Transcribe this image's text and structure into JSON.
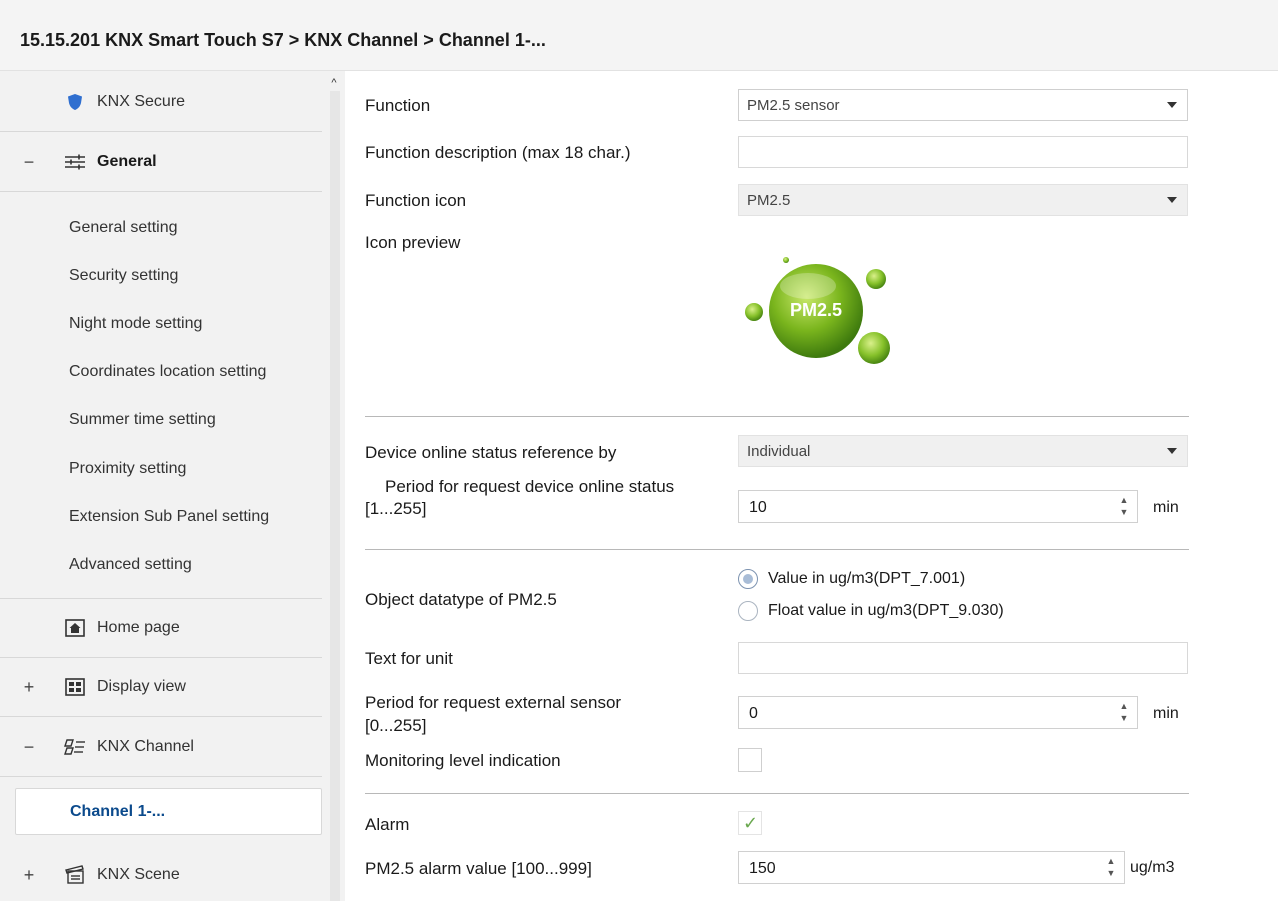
{
  "breadcrumb": "15.15.201 KNX Smart Touch S7 > KNX Channel  > Channel 1-...",
  "sidebar": {
    "knx_secure": "KNX Secure",
    "general": {
      "toggle": "−",
      "label": "General"
    },
    "general_items": [
      "General setting",
      "Security setting",
      "Night mode setting",
      "Coordinates location setting",
      "Summer time setting",
      "Proximity setting",
      "Extension Sub Panel setting",
      "Advanced setting"
    ],
    "home_page": "Home page",
    "display_view": {
      "toggle": "+",
      "label": "Display view"
    },
    "knx_channel": {
      "toggle": "−",
      "label": "KNX Channel"
    },
    "selected_channel": "Channel 1-...",
    "knx_scene": {
      "toggle": "+",
      "label": "KNX Scene"
    },
    "scroll_up": "^"
  },
  "form": {
    "function": {
      "label": "Function",
      "value": "PM2.5 sensor"
    },
    "function_description": {
      "label": "Function description (max 18 char.)",
      "value": ""
    },
    "function_icon": {
      "label": "Function icon",
      "value": "PM2.5"
    },
    "icon_preview": {
      "label": "Icon preview",
      "icon_text": "PM2.5"
    },
    "device_online_ref": {
      "label": "Device online status reference by",
      "value": "Individual"
    },
    "period_online": {
      "label_line1": "Period for request device online status",
      "label_line2": "[1...255]",
      "value": "10",
      "unit": "min"
    },
    "object_datatype": {
      "label": "Object datatype of PM2.5",
      "options": [
        "Value in ug/m3(DPT_7.001)",
        "Float value in ug/m3(DPT_9.030)"
      ],
      "selected_index": 0
    },
    "text_for_unit": {
      "label": "Text for unit",
      "value": ""
    },
    "period_external": {
      "label_line1": "Period for request external sensor",
      "label_line2": "[0...255]",
      "value": "0",
      "unit": "min"
    },
    "monitoring_level": {
      "label": "Monitoring level indication",
      "checked": false
    },
    "alarm": {
      "label": "Alarm",
      "checked": true,
      "check_glyph": "✓"
    },
    "alarm_value": {
      "label": "PM2.5 alarm value [100...999]",
      "value": "150",
      "unit": "ug/m3"
    }
  },
  "icons": {
    "shield": "shield-icon",
    "general": "sliders-icon",
    "home": "home-icon",
    "display": "display-view-icon",
    "channel": "knx-channel-icon",
    "scene": "scene-icon",
    "spin": "spinner-arrows-icon"
  },
  "colors": {
    "accent_link": "#0b4a8c",
    "shield": "#2f6fd0",
    "pm_green": "#7ab51d",
    "check_green": "#6aa84f"
  }
}
